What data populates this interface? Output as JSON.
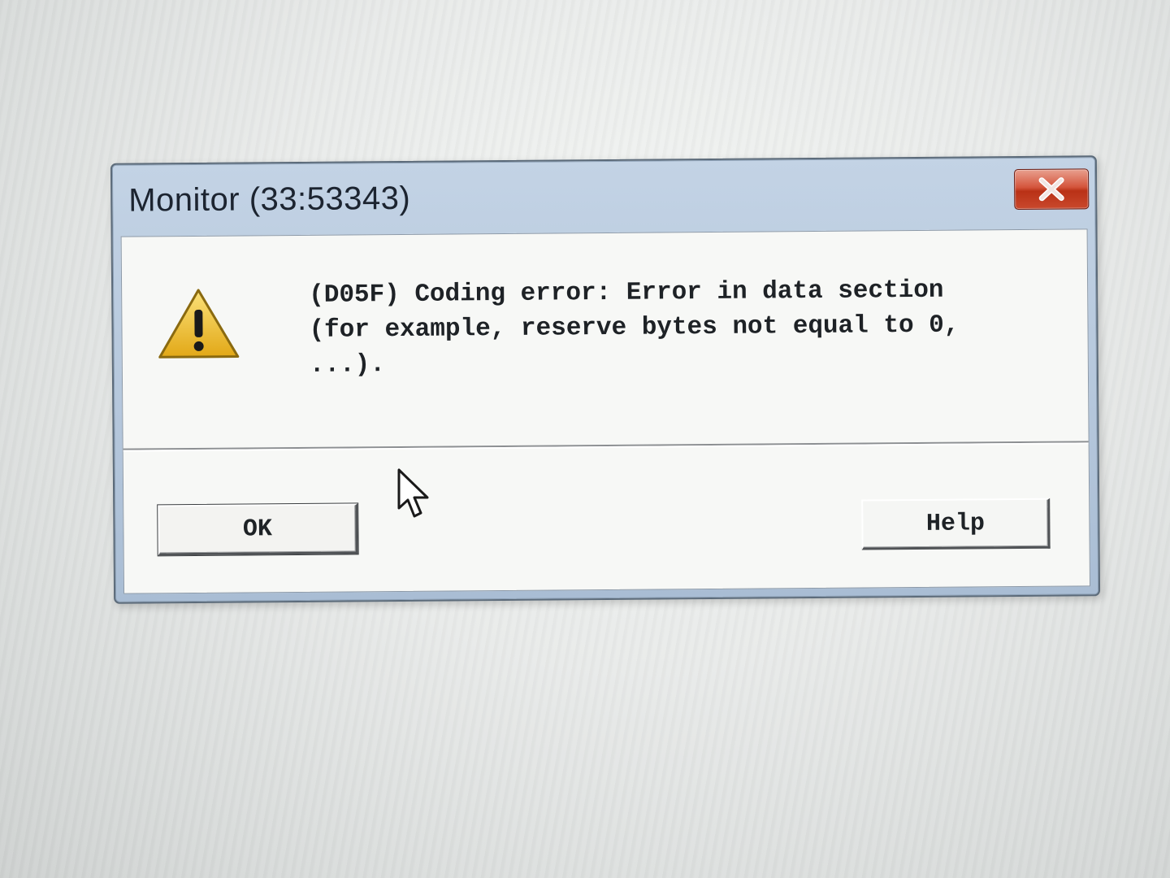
{
  "window": {
    "title": "Monitor (33:53343)",
    "close_icon": "close-icon"
  },
  "dialog": {
    "icon": "warning-icon",
    "message": "(D05F) Coding error: Error in data section\n(for example, reserve bytes not equal to 0,\n...).",
    "ok_label": "OK",
    "help_label": "Help"
  },
  "colors": {
    "title_bar": "#b4c6db",
    "close_button": "#c9482c",
    "client_background": "#f7f8f6",
    "warning_yellow": "#f2c72a"
  },
  "pointer": {
    "icon": "cursor-arrow-icon"
  }
}
